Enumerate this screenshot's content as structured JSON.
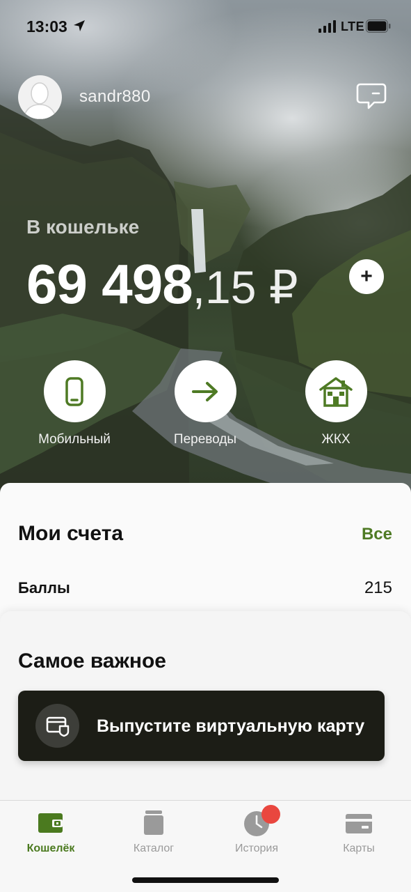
{
  "status_bar": {
    "time": "13:03",
    "network": "LTE"
  },
  "profile": {
    "username": "sandr880"
  },
  "wallet": {
    "label": "В кошельке",
    "balance_integer": "69 498",
    "balance_fraction": ",15 ₽",
    "add_label": "+"
  },
  "actions": [
    {
      "label": "Мобильный",
      "icon": "phone-icon"
    },
    {
      "label": "Переводы",
      "icon": "arrow-right-icon"
    },
    {
      "label": "ЖКХ",
      "icon": "house-icon"
    }
  ],
  "accounts": {
    "title": "Мои счета",
    "all_link": "Все",
    "rows": [
      {
        "label": "Баллы",
        "value": "215"
      }
    ]
  },
  "important": {
    "title": "Самое важное",
    "promo_text": "Выпустите виртуальную карту"
  },
  "tabbar": {
    "tabs": [
      {
        "label": "Кошелёк",
        "icon": "wallet-icon",
        "active": true
      },
      {
        "label": "Каталог",
        "icon": "catalog-icon",
        "active": false
      },
      {
        "label": "История",
        "icon": "clock-icon",
        "active": false,
        "badge": true
      },
      {
        "label": "Карты",
        "icon": "card-icon",
        "active": false
      }
    ]
  },
  "colors": {
    "accent": "#4e7a24",
    "promo_bg": "#1c1d16",
    "badge": "#e9473f"
  }
}
